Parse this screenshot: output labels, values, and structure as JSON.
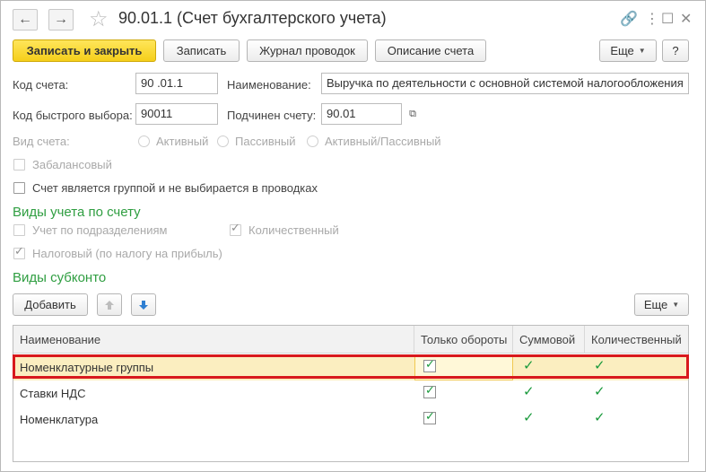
{
  "window": {
    "title": "90.01.1 (Счет бухгалтерского учета)",
    "icons": {
      "back": "arrow-left-icon",
      "forward": "arrow-right-icon",
      "favorite": "star-icon",
      "link": "link-icon",
      "more": "more-vertical-icon",
      "maximize": "maximize-icon",
      "close": "close-icon"
    },
    "back_glyph": "←",
    "forward_glyph": "→",
    "star_glyph": "☆",
    "link_glyph": "🔗",
    "more_glyph": "⋮",
    "maximize_glyph": "☐",
    "close_glyph": "✕"
  },
  "toolbar": {
    "save_close": "Записать и закрыть",
    "save": "Записать",
    "journal": "Журнал проводок",
    "description": "Описание счета",
    "more": "Еще",
    "help": "?"
  },
  "form": {
    "code_label": "Код счета:",
    "code_value": "90 .01.1",
    "name_label": "Наименование:",
    "name_value": "Выручка по деятельности с основной системой налогообложения",
    "quick_label": "Код быстрого выбора:",
    "quick_value": "90011",
    "parent_label": "Подчинен счету:",
    "parent_value": "90.01",
    "type_label": "Вид счета:",
    "type_options": [
      "Активный",
      "Пассивный",
      "Активный/Пассивный"
    ],
    "offbalance_label": "Забалансовый",
    "group_label": "Счет является группой и не выбирается в проводках"
  },
  "accounting": {
    "title": "Виды учета по счету",
    "by_division": "Учет по подразделениям",
    "quantitative": "Количественный",
    "tax": "Налоговый (по налогу на прибыль)"
  },
  "subconto": {
    "title": "Виды субконто",
    "add": "Добавить",
    "more": "Еще",
    "columns": [
      "Наименование",
      "Только обороты",
      "Суммовой",
      "Количественный"
    ],
    "rows": [
      {
        "name": "Номенклатурные группы",
        "turnover_only": true,
        "sum": true,
        "quantity": true
      },
      {
        "name": "Ставки НДС",
        "turnover_only": true,
        "sum": true,
        "quantity": true
      },
      {
        "name": "Номенклатура",
        "turnover_only": true,
        "sum": true,
        "quantity": true
      }
    ],
    "selected_row": 0
  },
  "colors": {
    "primary_button": "#f5cf1a",
    "section_title": "#2f9e41",
    "selection_outline": "#d8191d",
    "check": "#1a9a3c"
  }
}
